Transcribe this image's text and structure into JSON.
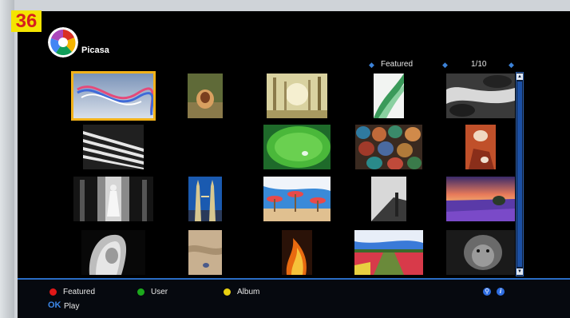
{
  "page_badge": "36",
  "app": {
    "name": "Picasa"
  },
  "topbar": {
    "category": "Featured",
    "page_counter": "1/10"
  },
  "photos": [
    {
      "name": "swirl-ribbons-photo",
      "selected": true
    },
    {
      "name": "shell-photo"
    },
    {
      "name": "misty-forest-photo"
    },
    {
      "name": "green-curves-photo"
    },
    {
      "name": "water-rocks-photo"
    },
    {
      "name": "striped-stairs-photo"
    },
    {
      "name": "lotus-leaf-photo"
    },
    {
      "name": "pebbles-photo"
    },
    {
      "name": "rock-arch-photo"
    },
    {
      "name": "woman-corridor-photo"
    },
    {
      "name": "petronas-towers-photo"
    },
    {
      "name": "beach-umbrellas-photo"
    },
    {
      "name": "street-photo"
    },
    {
      "name": "lavender-field-photo"
    },
    {
      "name": "hair-portrait-photo"
    },
    {
      "name": "sand-photo"
    },
    {
      "name": "fire-photo"
    },
    {
      "name": "tulip-field-photo"
    },
    {
      "name": "monkey-photo"
    }
  ],
  "footer": {
    "legend": [
      {
        "label": "Featured",
        "color": "#e01818"
      },
      {
        "label": "User",
        "color": "#1ca81c"
      },
      {
        "label": "Album",
        "color": "#e8d010"
      }
    ],
    "ok_key": "OK",
    "ok_label": "Play",
    "icons": [
      "search-icon",
      "info-icon"
    ]
  },
  "colors": {
    "selection": "#f2b21a",
    "accent": "#2a6cc4",
    "background": "#000000"
  }
}
